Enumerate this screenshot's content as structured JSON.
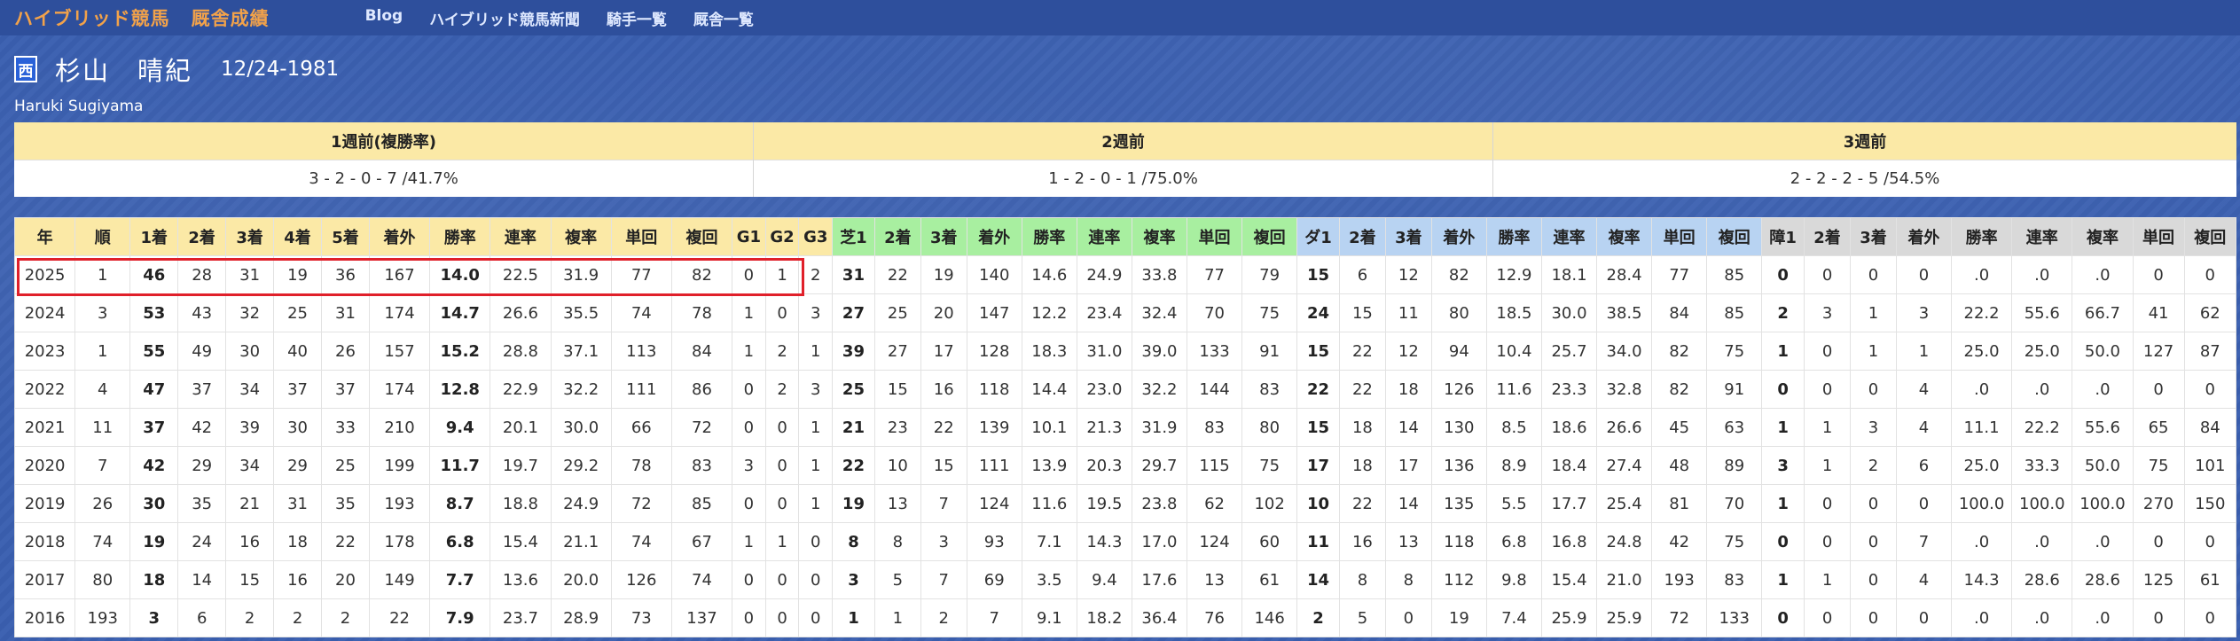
{
  "site": {
    "title": "ハイブリッド競馬",
    "subtitle": "厩舎成績"
  },
  "nav": [
    "Blog",
    "ハイブリッド競馬新聞",
    "騎手一覧",
    "厩舎一覧"
  ],
  "jockey": {
    "region": "西",
    "name": "杉山　晴紀",
    "birth": "12/24-1981",
    "romaji": "Haruki Sugiyama"
  },
  "weeks": [
    {
      "label": "1週前(複勝率)",
      "value": "3 - 2 - 0 - 7 /41.7%"
    },
    {
      "label": "2週前",
      "value": "1 - 2 - 0 - 1 /75.0%"
    },
    {
      "label": "3週前",
      "value": "2 - 2 - 2 - 5 /54.5%"
    }
  ],
  "colors": {
    "highlight": "#e0202a",
    "overall_header": "#fbe9a6",
    "turf_header": "#a8efa0",
    "dirt_header": "#b8d3f2",
    "jump_header": "#d9d9d9"
  },
  "table": {
    "headers": [
      "年",
      "順",
      "1着",
      "2着",
      "3着",
      "4着",
      "5着",
      "着外",
      "勝率",
      "連率",
      "複率",
      "単回",
      "複回",
      "G1",
      "G2",
      "G3",
      "芝1",
      "2着",
      "3着",
      "着外",
      "勝率",
      "連率",
      "複率",
      "単回",
      "複回",
      "ダ1",
      "2着",
      "3着",
      "着外",
      "勝率",
      "連率",
      "複率",
      "単回",
      "複回",
      "障1",
      "2着",
      "3着",
      "着外",
      "勝率",
      "連率",
      "複率",
      "単回",
      "複回"
    ],
    "highlighted_row": "2025",
    "rows": [
      [
        "2025",
        "1",
        "46",
        "28",
        "31",
        "19",
        "36",
        "167",
        "14.0",
        "22.5",
        "31.9",
        "77",
        "82",
        "0",
        "1",
        "2",
        "31",
        "22",
        "19",
        "140",
        "14.6",
        "24.9",
        "33.8",
        "77",
        "79",
        "15",
        "6",
        "12",
        "82",
        "12.9",
        "18.1",
        "28.4",
        "77",
        "85",
        "0",
        "0",
        "0",
        "0",
        ".0",
        ".0",
        ".0",
        "0",
        "0"
      ],
      [
        "2024",
        "3",
        "53",
        "43",
        "32",
        "25",
        "31",
        "174",
        "14.7",
        "26.6",
        "35.5",
        "74",
        "78",
        "1",
        "0",
        "3",
        "27",
        "25",
        "20",
        "147",
        "12.2",
        "23.4",
        "32.4",
        "70",
        "75",
        "24",
        "15",
        "11",
        "80",
        "18.5",
        "30.0",
        "38.5",
        "84",
        "85",
        "2",
        "3",
        "1",
        "3",
        "22.2",
        "55.6",
        "66.7",
        "41",
        "62"
      ],
      [
        "2023",
        "1",
        "55",
        "49",
        "30",
        "40",
        "26",
        "157",
        "15.2",
        "28.8",
        "37.1",
        "113",
        "84",
        "1",
        "2",
        "1",
        "39",
        "27",
        "17",
        "128",
        "18.3",
        "31.0",
        "39.0",
        "133",
        "91",
        "15",
        "22",
        "12",
        "94",
        "10.4",
        "25.7",
        "34.0",
        "82",
        "75",
        "1",
        "0",
        "1",
        "1",
        "25.0",
        "25.0",
        "50.0",
        "127",
        "87"
      ],
      [
        "2022",
        "4",
        "47",
        "37",
        "34",
        "37",
        "37",
        "174",
        "12.8",
        "22.9",
        "32.2",
        "111",
        "86",
        "0",
        "2",
        "3",
        "25",
        "15",
        "16",
        "118",
        "14.4",
        "23.0",
        "32.2",
        "144",
        "83",
        "22",
        "22",
        "18",
        "126",
        "11.6",
        "23.3",
        "32.8",
        "82",
        "91",
        "0",
        "0",
        "0",
        "4",
        ".0",
        ".0",
        ".0",
        "0",
        "0"
      ],
      [
        "2021",
        "11",
        "37",
        "42",
        "39",
        "30",
        "33",
        "210",
        "9.4",
        "20.1",
        "30.0",
        "66",
        "72",
        "0",
        "0",
        "1",
        "21",
        "23",
        "22",
        "139",
        "10.1",
        "21.3",
        "31.9",
        "83",
        "80",
        "15",
        "18",
        "14",
        "130",
        "8.5",
        "18.6",
        "26.6",
        "45",
        "63",
        "1",
        "1",
        "3",
        "4",
        "11.1",
        "22.2",
        "55.6",
        "65",
        "84"
      ],
      [
        "2020",
        "7",
        "42",
        "29",
        "34",
        "29",
        "25",
        "199",
        "11.7",
        "19.7",
        "29.2",
        "78",
        "83",
        "3",
        "0",
        "1",
        "22",
        "10",
        "15",
        "111",
        "13.9",
        "20.3",
        "29.7",
        "115",
        "75",
        "17",
        "18",
        "17",
        "136",
        "8.9",
        "18.4",
        "27.4",
        "48",
        "89",
        "3",
        "1",
        "2",
        "6",
        "25.0",
        "33.3",
        "50.0",
        "75",
        "101"
      ],
      [
        "2019",
        "26",
        "30",
        "35",
        "21",
        "31",
        "35",
        "193",
        "8.7",
        "18.8",
        "24.9",
        "72",
        "85",
        "0",
        "0",
        "1",
        "19",
        "13",
        "7",
        "124",
        "11.6",
        "19.5",
        "23.8",
        "62",
        "102",
        "10",
        "22",
        "14",
        "135",
        "5.5",
        "17.7",
        "25.4",
        "81",
        "70",
        "1",
        "0",
        "0",
        "0",
        "100.0",
        "100.0",
        "100.0",
        "270",
        "150"
      ],
      [
        "2018",
        "74",
        "19",
        "24",
        "16",
        "18",
        "22",
        "178",
        "6.8",
        "15.4",
        "21.1",
        "74",
        "67",
        "1",
        "1",
        "0",
        "8",
        "8",
        "3",
        "93",
        "7.1",
        "14.3",
        "17.0",
        "124",
        "60",
        "11",
        "16",
        "13",
        "118",
        "6.8",
        "16.8",
        "24.8",
        "42",
        "75",
        "0",
        "0",
        "0",
        "7",
        ".0",
        ".0",
        ".0",
        "0",
        "0"
      ],
      [
        "2017",
        "80",
        "18",
        "14",
        "15",
        "16",
        "20",
        "149",
        "7.7",
        "13.6",
        "20.0",
        "126",
        "74",
        "0",
        "0",
        "0",
        "3",
        "5",
        "7",
        "69",
        "3.5",
        "9.4",
        "17.6",
        "13",
        "61",
        "14",
        "8",
        "8",
        "112",
        "9.8",
        "15.4",
        "21.0",
        "193",
        "83",
        "1",
        "1",
        "0",
        "4",
        "14.3",
        "28.6",
        "28.6",
        "125",
        "61"
      ],
      [
        "2016",
        "193",
        "3",
        "6",
        "2",
        "2",
        "2",
        "22",
        "7.9",
        "23.7",
        "28.9",
        "73",
        "137",
        "0",
        "0",
        "0",
        "1",
        "1",
        "2",
        "7",
        "9.1",
        "18.2",
        "36.4",
        "76",
        "146",
        "2",
        "5",
        "0",
        "19",
        "7.4",
        "25.9",
        "25.9",
        "72",
        "133",
        "0",
        "0",
        "0",
        "0",
        ".0",
        ".0",
        ".0",
        "0",
        "0"
      ]
    ]
  }
}
